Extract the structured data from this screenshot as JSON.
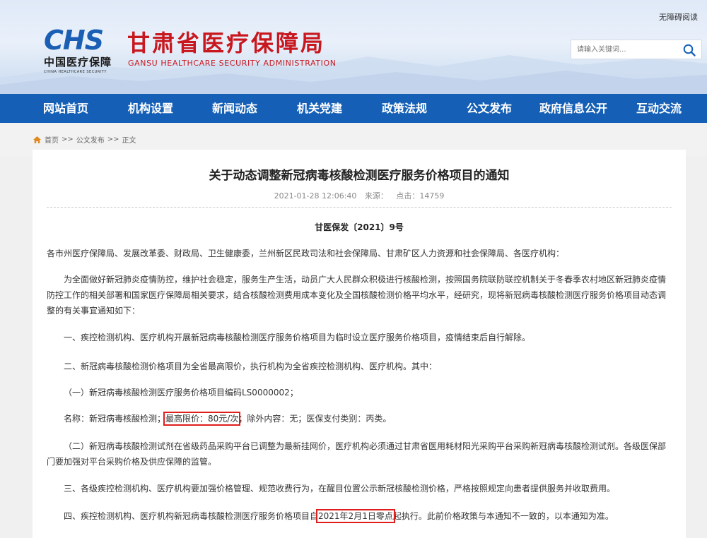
{
  "header": {
    "logo_mark": "CHS",
    "logo_cn": "中国医疗保障",
    "logo_en": "CHINA HEALTHCARE SECURITY",
    "site_title": "甘肃省医疗保障局",
    "site_subtitle": "GANSU HEALTHCARE SECURITY ADMINISTRATION",
    "accessibility": "无障碍阅读",
    "search_placeholder": "请输入关键词...",
    "brand_color": "#c8171e",
    "logo_color": "#1a5fb4"
  },
  "nav": {
    "color": "#1560b6",
    "items": [
      "网站首页",
      "机构设置",
      "新闻动态",
      "机关党建",
      "政策法规",
      "公文发布",
      "政府信息公开",
      "互动交流"
    ]
  },
  "breadcrumb": {
    "home": "首页",
    "sep1": ">>",
    "section": "公文发布",
    "sep2": ">>",
    "current": "正文"
  },
  "article": {
    "title": "关于动态调整新冠病毒核酸检测医疗服务价格项目的通知",
    "date": "2021-01-28 12:06:40",
    "source": "来源：",
    "clicks": "点击：14759",
    "doc_number": "甘医保发〔2021〕9号",
    "recipients": "各市州医疗保障局、发展改革委、财政局、卫生健康委，兰州新区民政司法和社会保障局、甘肃矿区人力资源和社会保障局、各医疗机构：",
    "intro": "为全面做好新冠肺炎疫情防控，维护社会稳定，服务生产生活，动员广大人民群众积极进行核酸检测，按照国务院联防联控机制关于冬春季农村地区新冠肺炎疫情防控工作的相关部署和国家医疗保障局相关要求，结合核酸检测费用成本变化及全国核酸检测价格平均水平，经研究，现将新冠病毒核酸检测医疗服务价格项目动态调整的有关事宜通知如下：",
    "item1": "一、疾控检测机构、医疗机构开展新冠病毒核酸检测医疗服务价格项目为临时设立医疗服务价格项目，疫情结束后自行解除。",
    "item2": "二、新冠病毒核酸检测价格项目为全省最高限价，执行机构为全省疾控检测机构、医疗机构。其中：",
    "item2_1": "（一）新冠病毒核酸检测医疗服务价格项目编码LS0000002；",
    "name_pre": "名称：新冠病毒核酸检测；",
    "name_hl": "最高限价：80元/次",
    "name_post": "；除外内容：无；医保支付类别：丙类。",
    "item2_2": "（二）新冠病毒核酸检测试剂在省级药品采购平台已调整为最新挂网价，医疗机构必须通过甘肃省医用耗材阳光采购平台采购新冠病毒核酸检测试剂。各级医保部门要加强对平台采购价格及供应保障的监管。",
    "item3": "三、各级疾控检测机构、医疗机构要加强价格管理、规范收费行为，在醒目位置公示新冠核酸检测价格，严格按照规定向患者提供服务并收取费用。",
    "item4_pre": "四、疾控检测机构、医疗机构新冠病毒核酸检测医疗服务价格项目自",
    "item4_hl": "2021年2月1日零点",
    "item4_post": "起执行。此前价格政策与本通知不一致的，以本通知为准。"
  }
}
